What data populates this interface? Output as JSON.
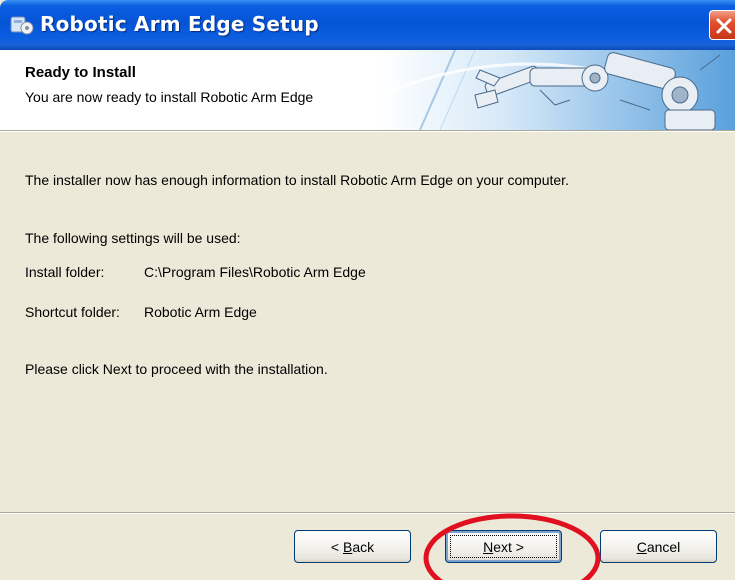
{
  "window": {
    "title": "Robotic Arm Edge Setup"
  },
  "banner": {
    "title": "Ready to Install",
    "subtitle": "You are now ready to install Robotic Arm Edge"
  },
  "body": {
    "intro": "The installer now has enough information to install Robotic Arm Edge on your computer.",
    "settings_heading": "The following settings will be used:",
    "install_folder_label": "Install folder:",
    "install_folder_value": "C:\\Program Files\\Robotic Arm Edge",
    "shortcut_folder_label": "Shortcut folder:",
    "shortcut_folder_value": "Robotic Arm Edge",
    "instruction": "Please click Next to proceed with the installation."
  },
  "buttons": {
    "back": {
      "prefix": "< ",
      "mnemonic": "B",
      "rest": "ack"
    },
    "next": {
      "mnemonic": "N",
      "rest": "ext >"
    },
    "cancel": {
      "mnemonic": "C",
      "rest": "ancel"
    }
  },
  "colors": {
    "titlebar": "#0554d6",
    "dialog_bg": "#ece9d8",
    "highlight": "#e01020"
  }
}
